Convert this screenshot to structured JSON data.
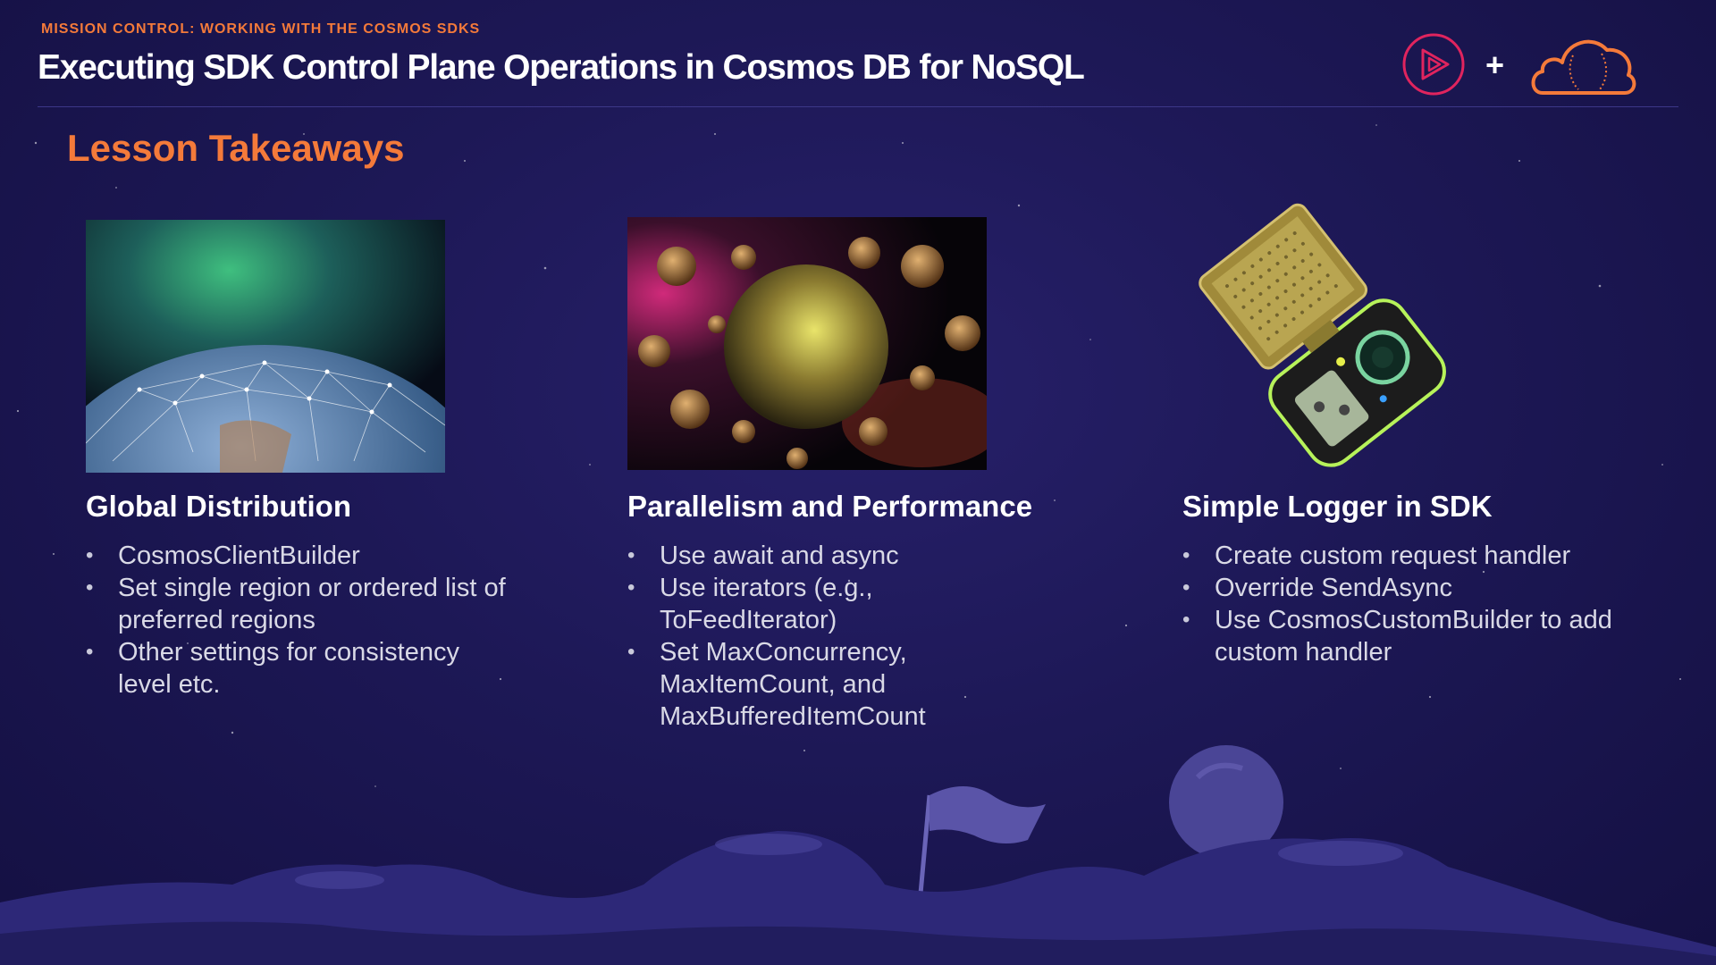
{
  "header": {
    "kicker": "MISSION CONTROL: WORKING WITH THE COSMOS SDKS",
    "title": "Executing SDK Control Plane Operations in Cosmos DB for NoSQL",
    "plus": "+"
  },
  "section_title": "Lesson Takeaways",
  "columns": [
    {
      "title": "Global Distribution",
      "image": "earth-network-image",
      "items": [
        "CosmosClientBuilder",
        "Set single region or ordered list of preferred regions",
        "Other settings for consistency level etc."
      ]
    },
    {
      "title": "Parallelism and Performance",
      "image": "planets-image",
      "items": [
        "Use await and async",
        "Use iterators (e.g., ToFeedIterator)",
        "Set MaxConcurrency, MaxItemCount, and MaxBufferedItemCount"
      ]
    },
    {
      "title": "Simple Logger in SDK",
      "image": "communicator-image",
      "items": [
        "Create custom request handler",
        "Override SendAsync",
        "Use CosmosCustomBuilder to add custom handler"
      ]
    }
  ],
  "colors": {
    "accent": "#f47a3a",
    "background": "#1d1856",
    "text": "#ffffff",
    "body_text": "#d9d9e6",
    "logo_play": "#e0245e"
  }
}
